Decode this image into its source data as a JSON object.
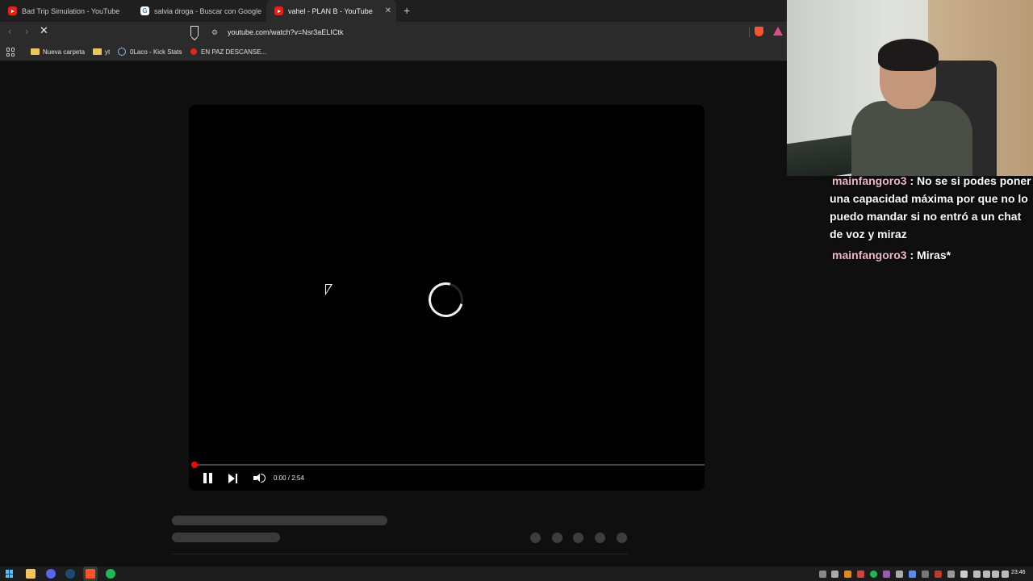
{
  "browser": {
    "tabs": [
      {
        "title": "Bad Trip Simulation - YouTube",
        "favicon": "youtube-icon",
        "active": false
      },
      {
        "title": "salvia droga - Buscar con Google",
        "favicon": "google-icon",
        "active": false
      },
      {
        "title": "vahel - PLAN B - YouTube",
        "favicon": "youtube-icon",
        "active": true
      }
    ],
    "new_tab_label": "+",
    "close_tab_label": "✕",
    "url": "youtube.com/watch?v=Nsr3aELICtk",
    "bookmarks": [
      {
        "label": "Nueva carpeta",
        "icon": "folder-icon"
      },
      {
        "label": "yt",
        "icon": "folder-icon"
      },
      {
        "label": "0Laco - Kick Stats",
        "icon": "kick-stats-icon"
      },
      {
        "label": "EN PAZ DESCANSE...",
        "icon": "youtube-icon"
      }
    ],
    "back_label": "‹",
    "forward_label": "›",
    "stop_label": "✕"
  },
  "player": {
    "state": "loading",
    "current_time": "0:00",
    "duration": "2:54",
    "time_display": "0:00 / 2:54",
    "progress_fraction": 0.005,
    "colors": {
      "progress": "#ff0000",
      "background": "#000000"
    }
  },
  "chat": {
    "messages": [
      {
        "user": "mainfangoro3",
        "text": "No se si podes poner una capacidad máxima por que no lo puedo mandar si no entró a un chat de voz y miraz"
      },
      {
        "user": "mainfangoro3",
        "text": "Miras*"
      }
    ],
    "separator": " : "
  },
  "taskbar": {
    "pinned_icons": [
      "windows-start-icon",
      "file-explorer-icon",
      "discord-icon",
      "steam-icon",
      "brave-browser-icon",
      "spotify-icon"
    ],
    "tray_icons": [
      "chevron-up-icon",
      "controller-icon",
      "app-icon",
      "app-icon",
      "spotify-icon",
      "app-icon",
      "steam-icon",
      "app-icon",
      "app-icon",
      "app-icon",
      "app-icon",
      "app-icon",
      "network-icon",
      "battery-icon",
      "microphone-icon",
      "volume-icon",
      "keyboard-icon"
    ],
    "clock": "23:46"
  }
}
